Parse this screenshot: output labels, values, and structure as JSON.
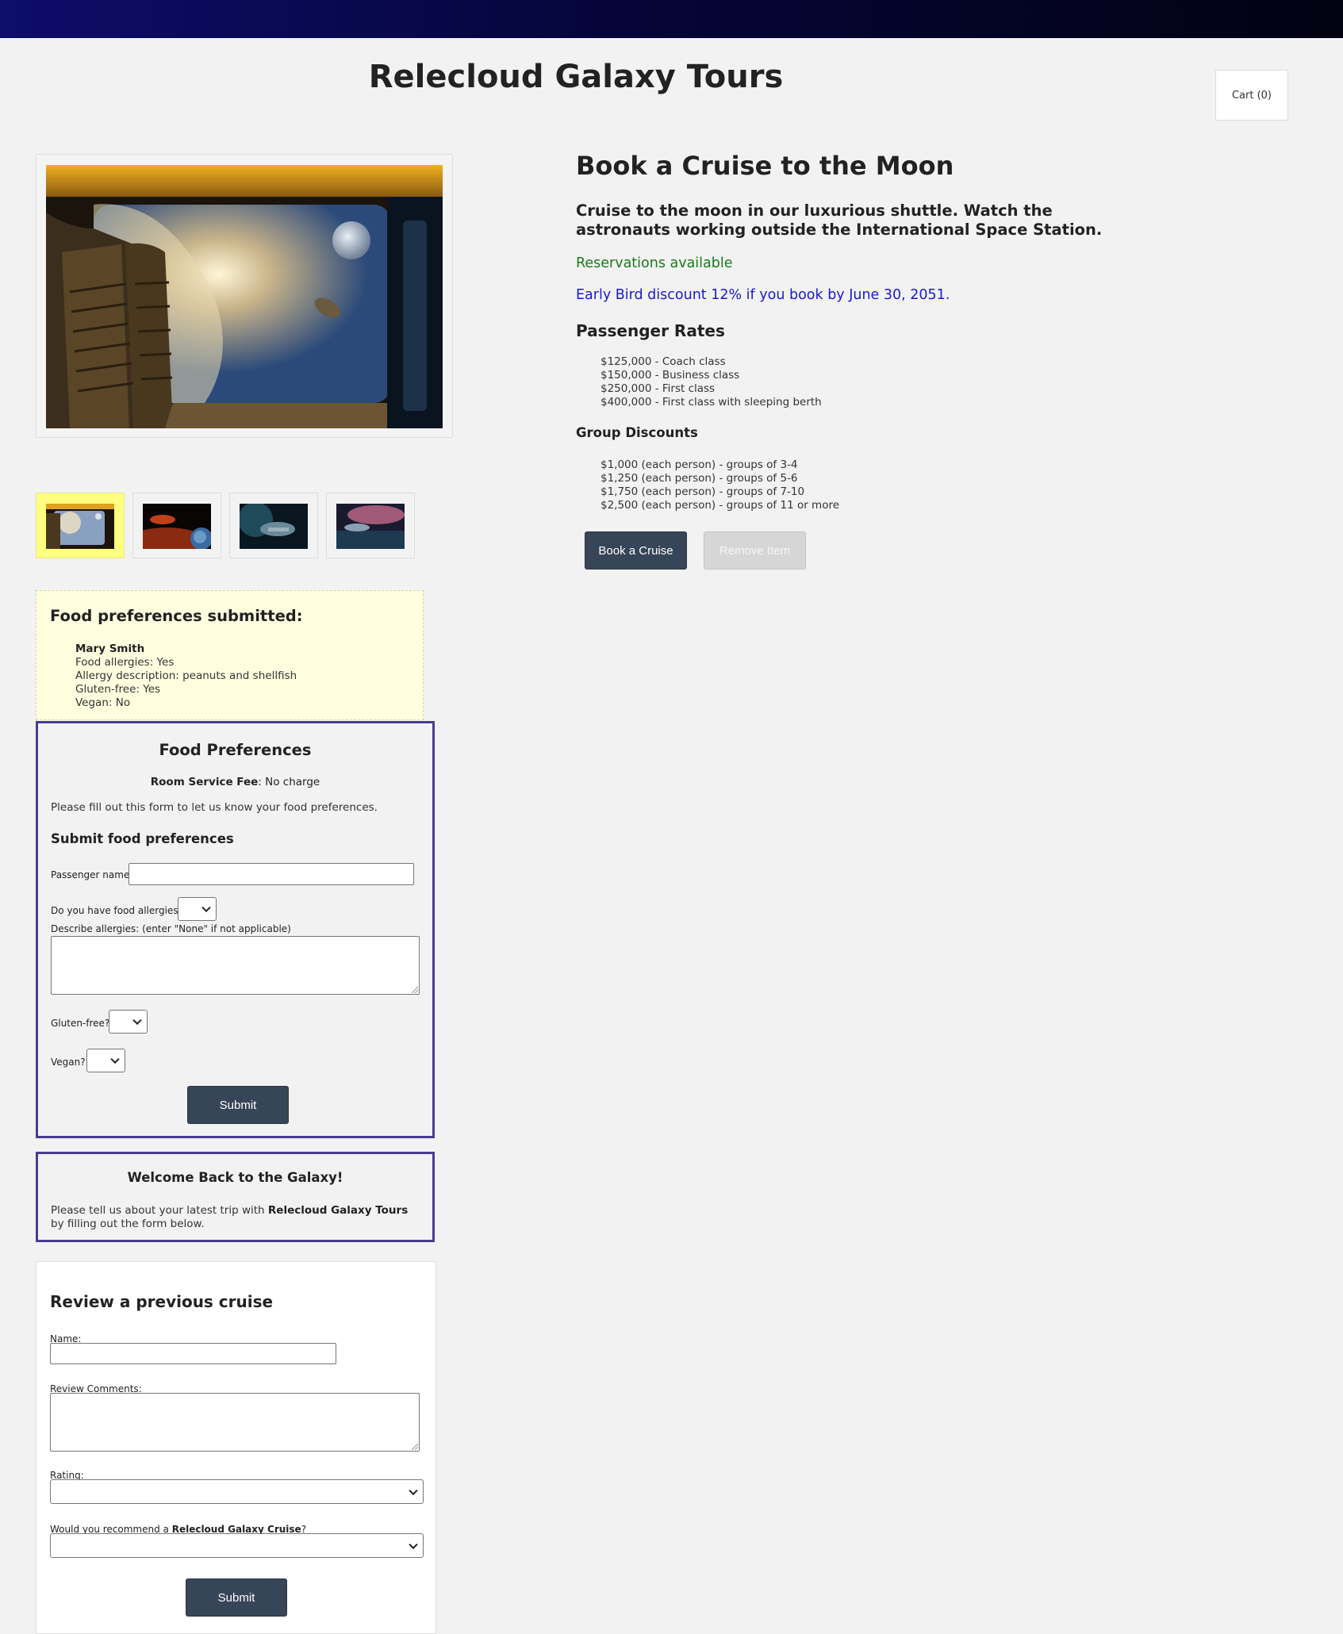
{
  "header": {
    "site_title": "Relecloud Galaxy Tours",
    "cart_label": "Cart (0)"
  },
  "gallery": {
    "main_image": "spaceship-window-moon",
    "thumbnails": [
      {
        "name": "spaceship-window-moon",
        "active": true
      },
      {
        "name": "red-planet-surface",
        "active": false
      },
      {
        "name": "earth-orbit-ship",
        "active": false
      },
      {
        "name": "pink-nebula-ship",
        "active": false
      }
    ]
  },
  "product": {
    "title": "Book a Cruise to the Moon",
    "description": "Cruise to the moon in our luxurious shuttle. Watch the astronauts working outside the International Space Station.",
    "availability": "Reservations available",
    "discount": "Early Bird discount 12% if you book by June 30, 2051.",
    "rates_heading": "Passenger Rates",
    "rates": [
      "$125,000 - Coach class",
      "$150,000 - Business class",
      "$250,000 - First class",
      "$400,000 - First class with sleeping berth"
    ],
    "group_heading": "Group Discounts",
    "group_discounts": [
      "$1,000 (each person) - groups of 3-4",
      "$1,250 (each person) - groups of 5-6",
      "$1,750 (each person) - groups of 7-10",
      "$2,500 (each person) - groups of 11 or more"
    ],
    "book_label": "Book a Cruise",
    "remove_label": "Remove Item"
  },
  "food_submitted": {
    "heading": "Food preferences submitted:",
    "name": "Mary Smith",
    "allergies": "Food allergies: Yes",
    "allergy_desc": "Allergy description: peanuts and shellfish",
    "gluten": "Gluten-free: Yes",
    "vegan": "Vegan: No"
  },
  "food_form": {
    "title": "Food Preferences",
    "fee_label": "Room Service Fee",
    "fee_value": ": No charge",
    "intro": "Please fill out this form to let us know your food preferences.",
    "subheading": "Submit food preferences",
    "passenger_label": "Passenger name:",
    "passenger_value": "",
    "allergies_label": "Do you have food allergies?",
    "describe_label": "Describe allergies: (enter \"None\" if not applicable)",
    "gluten_label": "Gluten-free?",
    "vegan_label": "Vegan?",
    "submit_label": "Submit"
  },
  "welcome": {
    "title": "Welcome Back to the Galaxy!",
    "text_before": "Please tell us about your latest trip with ",
    "brand": "Relecloud Galaxy Tours",
    "text_after": " by filling out the form below."
  },
  "review": {
    "heading": "Review a previous cruise",
    "name_label": "Name:",
    "comments_label": "Review Comments:",
    "rating_label": "Rating:",
    "recommend_before": "Would you recommend a ",
    "recommend_brand": "Relecloud Galaxy Cruise",
    "recommend_after": "?",
    "submit_label": "Submit"
  },
  "colors": {
    "topbar": "#0d0d6b",
    "panel_border": "#4b3c8c",
    "button": "#374558",
    "availability": "#1a7a1a",
    "discount": "#1a1acc",
    "submitted_bg": "#ffffe0",
    "active_thumb": "#ffff80"
  }
}
